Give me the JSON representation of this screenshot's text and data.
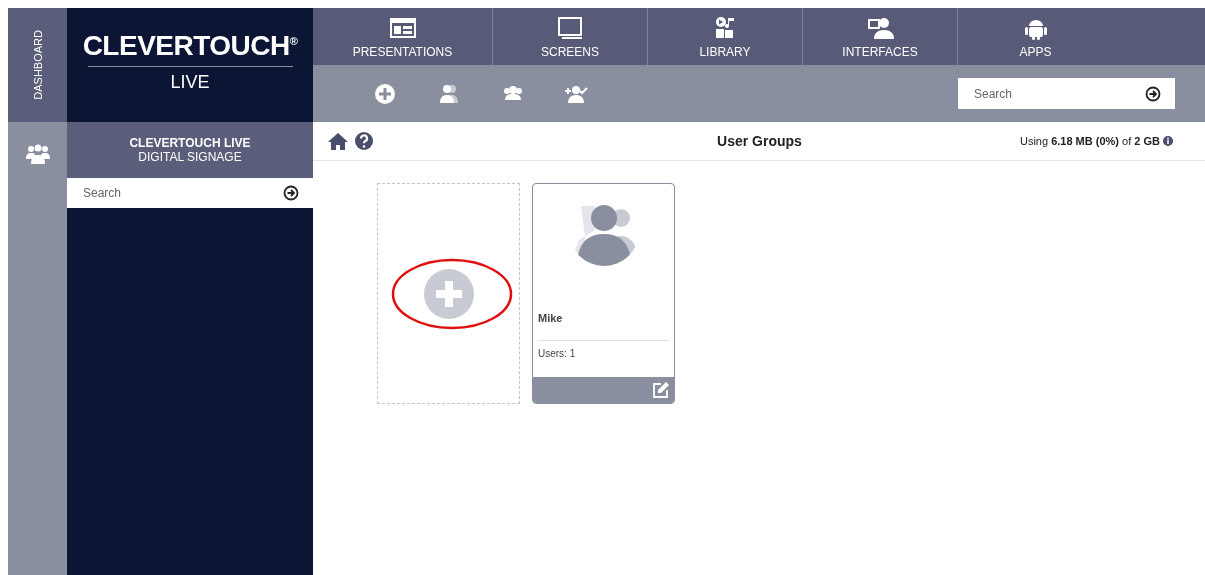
{
  "rail": {
    "items": [
      {
        "label": "DASHBOARD",
        "kind": "text"
      },
      {
        "kind": "groups"
      }
    ]
  },
  "logo": {
    "brand": "CLEVERTOUCH",
    "mark": "®",
    "product": "LIVE"
  },
  "sidebar": {
    "title": "CLEVERTOUCH LIVE",
    "subtitle": "DIGITAL SIGNAGE",
    "search": {
      "placeholder": "Search"
    }
  },
  "nav": {
    "tabs": [
      {
        "label": "PRESENTATIONS"
      },
      {
        "label": "SCREENS"
      },
      {
        "label": "LIBRARY"
      },
      {
        "label": "INTERFACES"
      },
      {
        "label": "APPS"
      }
    ]
  },
  "toolbar": {
    "search": {
      "placeholder": "Search"
    }
  },
  "header": {
    "title": "User Groups",
    "usage": "Using **6.18 MB (0%)** of **2 GB**"
  },
  "groups": [
    {
      "kind": "add",
      "highlighted": true
    },
    {
      "kind": "group",
      "name": "Mike",
      "users": "Users: 1"
    }
  ]
}
